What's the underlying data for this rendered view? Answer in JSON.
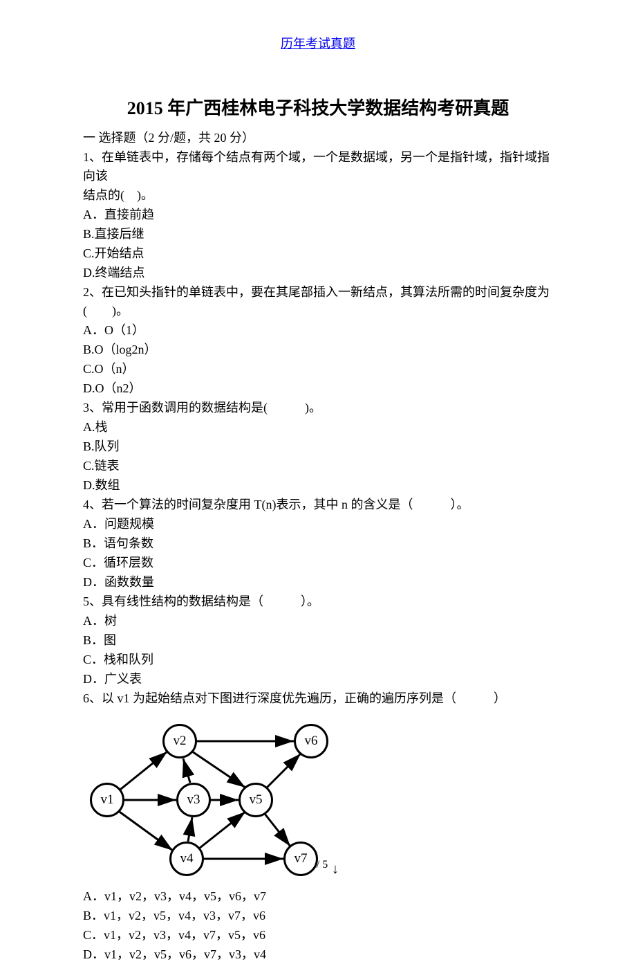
{
  "header_link": "历年考试真题",
  "title": "2015 年广西桂林电子科技大学数据结构考研真题",
  "section1": "一 选择题（2 分/题，共 20 分）",
  "q1": {
    "stem1": "1、在单链表中，存储每个结点有两个域，一个是数据域，另一个是指针域，指针域指向该",
    "stem2": "结点的(　)。",
    "a": "A．直接前趋",
    "b": "B.直接后继",
    "c": "C.开始结点",
    "d": "D.终端结点"
  },
  "q2": {
    "stem": "2、在已知头指针的单链表中，要在其尾部插入一新结点，其算法所需的时间复杂度为(　　)。",
    "a": "A．O（1）",
    "b": "B.O（log2n）",
    "c": "C.O（n）",
    "d": "D.O（n2）"
  },
  "q3": {
    "stem": "3、常用于函数调用的数据结构是(　　　)。",
    "a": "A.栈",
    "b": "B.队列",
    "c": "C.链表",
    "d": "D.数组"
  },
  "q4": {
    "stem": "4、若一个算法的时间复杂度用 T(n)表示，其中 n 的含义是（　　　）。",
    "a": "A．问题规模",
    "b": "B．语句条数",
    "c": "C．循环层数",
    "d": "D．函数数量"
  },
  "q5": {
    "stem": "5、具有线性结构的数据结构是（　　　）。",
    "a": "A．树",
    "b": "B．图",
    "c": "C．栈和队列",
    "d": "D．广义表"
  },
  "q6": {
    "stem": "6、以 v1 为起始结点对下图进行深度优先遍历，正确的遍历序列是（　　　）",
    "nodes": {
      "v1": "v1",
      "v2": "v2",
      "v3": "v3",
      "v4": "v4",
      "v5": "v5",
      "v6": "v6",
      "v7": "v7"
    },
    "a": "A．v1，v2，v3，v4，v5，v6，v7",
    "b": "B．v1，v2，v5，v4，v3，v7，v6",
    "c": "C．v1，v2，v3，v4，v7，v5，v6",
    "d": "D．v1，v2，v5，v6，v7，v3，v4"
  },
  "down_arrow": "↓",
  "page_num": "1 / 5"
}
